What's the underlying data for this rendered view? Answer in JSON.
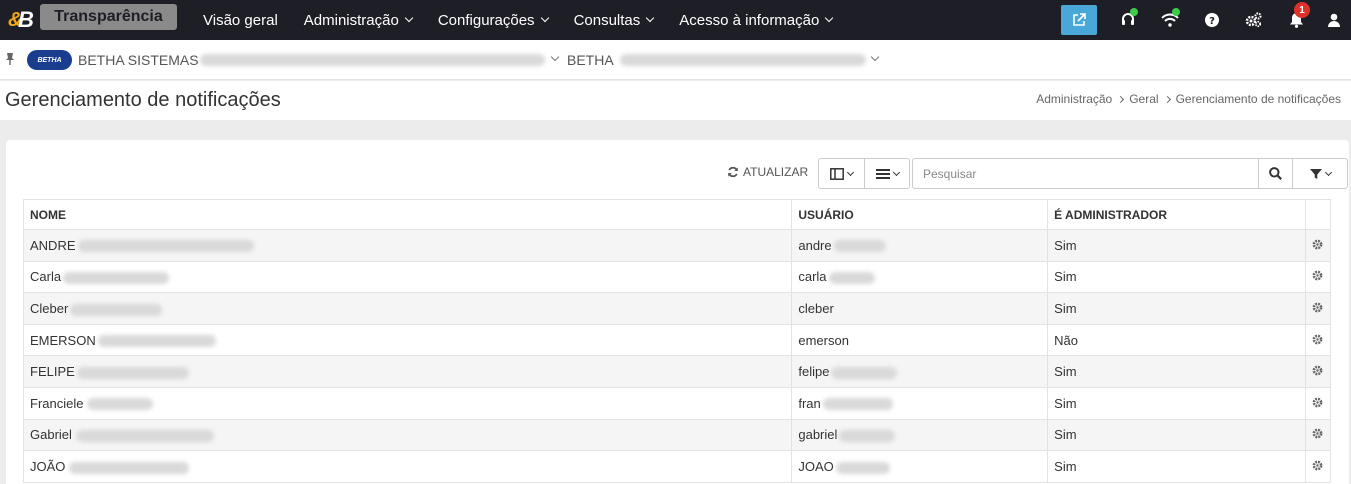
{
  "app": {
    "title": "Transparência"
  },
  "menu": [
    {
      "label": "Visão geral",
      "has_dropdown": false
    },
    {
      "label": "Administração",
      "has_dropdown": true
    },
    {
      "label": "Configurações",
      "has_dropdown": true
    },
    {
      "label": "Consultas",
      "has_dropdown": true
    },
    {
      "label": "Acesso à informação",
      "has_dropdown": true
    }
  ],
  "notifications": {
    "count": "1"
  },
  "context": {
    "org_logo_text": "BETHA",
    "org": "BETHA SISTEMAS",
    "system": "BETHA"
  },
  "page": {
    "title": "Gerenciamento de notificações"
  },
  "breadcrumb": [
    "Administração",
    "Geral",
    "Gerenciamento de notificações"
  ],
  "toolbar": {
    "refresh_label": "ATUALIZAR",
    "search_placeholder": "Pesquisar"
  },
  "table": {
    "headers": [
      "NOME",
      "USUÁRIO",
      "É ADMINISTRADOR"
    ],
    "rows": [
      {
        "name": "ANDRE",
        "user": "andre",
        "admin": "Sim"
      },
      {
        "name": "Carla",
        "user": "carla",
        "admin": "Sim"
      },
      {
        "name": "Cleber",
        "user": "cleber",
        "admin": "Sim"
      },
      {
        "name": "EMERSON",
        "user": "emerson",
        "admin": "Não"
      },
      {
        "name": "FELIPE",
        "user": "felipe",
        "admin": "Sim"
      },
      {
        "name": "Franciele",
        "user": "fran",
        "admin": "Sim"
      },
      {
        "name": "Gabriel",
        "user": "gabriel",
        "admin": "Sim"
      },
      {
        "name": "JOÃO",
        "user": "JOAO",
        "admin": "Sim"
      }
    ]
  },
  "colors": {
    "navbar": "#1e1e26",
    "accent": "#4aa8d8",
    "badge": "#e0302a",
    "online": "#3dcc4a"
  }
}
